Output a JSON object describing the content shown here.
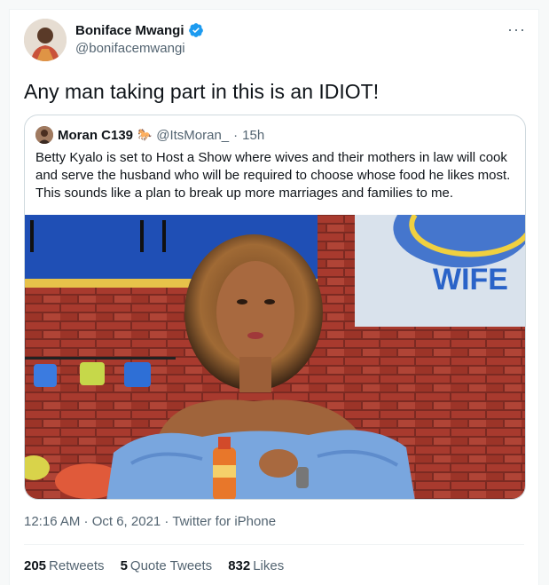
{
  "author": {
    "name": "Boniface Mwangi",
    "handle": "@bonifacemwangi",
    "verified_icon": "verified-badge-icon",
    "verified_color": "#1d9bf0"
  },
  "tweet": {
    "text": "Any man taking part in this is an IDIOT!",
    "more_icon": "more-options-icon",
    "more_glyph": "···"
  },
  "quoted_tweet": {
    "name": "Moran C139",
    "emoji": "🐎",
    "handle": "@ItsMoran_",
    "separator": "·",
    "time": "15h",
    "text": "Betty Kyalo is set to Host a Show where wives and their mothers in law will cook and serve the husband who will be required to choose whose food he likes most. This sounds like a plan to break up more marriages and families to me.",
    "image_sign_text": "WIFE"
  },
  "meta": {
    "timestamp": "12:16 AM · Oct 6, 2021 · Twitter for iPhone"
  },
  "stats": {
    "retweets_count": "205",
    "retweets_label": "Retweets",
    "quotes_count": "5",
    "quotes_label": "Quote Tweets",
    "likes_count": "832",
    "likes_label": "Likes"
  }
}
